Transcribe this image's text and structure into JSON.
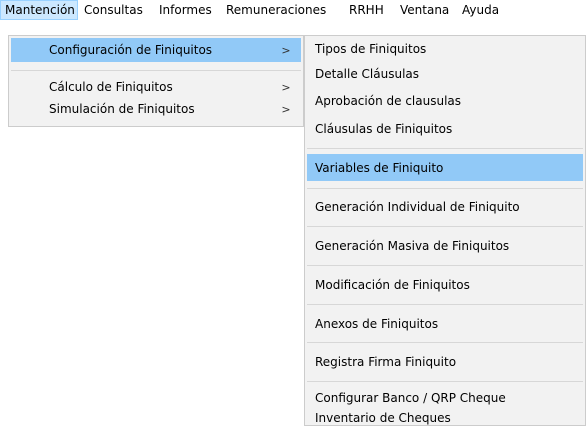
{
  "menubar": {
    "items": [
      "Mantención",
      "Consultas",
      "Informes",
      "Remuneraciones",
      "RRHH",
      "Ventana",
      "Ayuda"
    ]
  },
  "main_menu": {
    "items": [
      {
        "label": "Configuración de Finiquitos",
        "has_submenu": true,
        "highlighted": true
      },
      {
        "label": "Cálculo de Finiquitos",
        "has_submenu": true,
        "highlighted": false
      },
      {
        "label": "Simulación de Finiquitos",
        "has_submenu": true,
        "highlighted": false
      }
    ],
    "submenu_arrow": ">"
  },
  "submenu": {
    "items": [
      {
        "label": "Tipos de Finiquitos"
      },
      {
        "label": "Detalle Cláusulas"
      },
      {
        "label": "Aprobación de clausulas"
      },
      {
        "label": "Cláusulas de Finiquitos"
      },
      {
        "label": "Variables de Finiquito",
        "highlighted": true
      },
      {
        "label": "Generación Individual de Finiquito"
      },
      {
        "label": "Generación Masiva de Finiquitos"
      },
      {
        "label": "Modificación de Finiquitos"
      },
      {
        "label": "Anexos de Finiquitos"
      },
      {
        "label": "Registra Firma Finiquito"
      },
      {
        "label": "Configurar Banco / QRP Cheque"
      },
      {
        "label": "Inventario de Cheques"
      }
    ]
  },
  "colors": {
    "menubar_active_bg": "#cce8ff",
    "menu_bg": "#f2f2f2",
    "highlight_bg": "#91c9f7"
  }
}
